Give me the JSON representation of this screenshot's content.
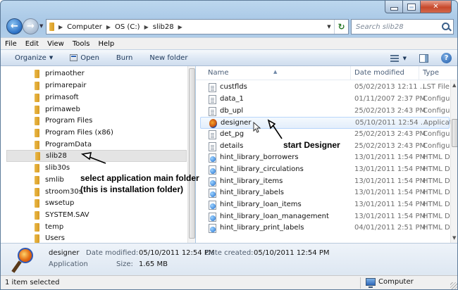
{
  "address": {
    "crumbs": [
      "Computer",
      "OS (C:)",
      "slib28"
    ]
  },
  "search": {
    "placeholder": "Search slib28"
  },
  "menubar": [
    "File",
    "Edit",
    "View",
    "Tools",
    "Help"
  ],
  "toolbar": {
    "organize": "Organize",
    "open": "Open",
    "burn": "Burn",
    "new_folder": "New folder"
  },
  "nav_items": [
    {
      "label": "primaother",
      "selected": false
    },
    {
      "label": "primarepair",
      "selected": false
    },
    {
      "label": "primasoft",
      "selected": false
    },
    {
      "label": "primaweb",
      "selected": false
    },
    {
      "label": "Program Files",
      "selected": false
    },
    {
      "label": "Program Files (x86)",
      "selected": false
    },
    {
      "label": "ProgramData",
      "selected": false
    },
    {
      "label": "slib28",
      "selected": true
    },
    {
      "label": "slib30s",
      "selected": false
    },
    {
      "label": "smlib",
      "selected": false
    },
    {
      "label": "stroom30s",
      "selected": false
    },
    {
      "label": "swsetup",
      "selected": false
    },
    {
      "label": "SYSTEM.SAV",
      "selected": false
    },
    {
      "label": "temp",
      "selected": false
    },
    {
      "label": "Users",
      "selected": false
    }
  ],
  "columns": {
    "name": "Name",
    "date": "Date modified",
    "type": "Type"
  },
  "files": [
    {
      "name": "custflds",
      "date": "05/02/2013 12:11 ...",
      "type": "LST File",
      "icon": "doc",
      "hover": false
    },
    {
      "name": "data_1",
      "date": "01/11/2007 2:37 PM",
      "type": "Configuration",
      "icon": "doc",
      "hover": false
    },
    {
      "name": "db_upl",
      "date": "25/02/2013 2:43 PM",
      "type": "Configuration",
      "icon": "doc",
      "hover": false
    },
    {
      "name": "designer",
      "date": "05/10/2011 12:54 ...",
      "type": "Application",
      "icon": "app",
      "hover": true
    },
    {
      "name": "det_pg",
      "date": "25/02/2013 2:43 PM",
      "type": "Configuration",
      "icon": "doc",
      "hover": false
    },
    {
      "name": "details",
      "date": "25/02/2013 2:43 PM",
      "type": "Configuration",
      "icon": "doc",
      "hover": false
    },
    {
      "name": "hint_library_borrowers",
      "date": "13/01/2011 1:54 PM",
      "type": "HTML Document",
      "icon": "html",
      "hover": false
    },
    {
      "name": "hint_library_circulations",
      "date": "13/01/2011 1:54 PM",
      "type": "HTML Document",
      "icon": "html",
      "hover": false
    },
    {
      "name": "hint_library_items",
      "date": "13/01/2011 1:54 PM",
      "type": "HTML Document",
      "icon": "html",
      "hover": false
    },
    {
      "name": "hint_library_labels",
      "date": "13/01/2011 1:54 PM",
      "type": "HTML Document",
      "icon": "html",
      "hover": false
    },
    {
      "name": "hint_library_loan_items",
      "date": "13/01/2011 1:54 PM",
      "type": "HTML Document",
      "icon": "html",
      "hover": false
    },
    {
      "name": "hint_library_loan_management",
      "date": "13/01/2011 1:54 PM",
      "type": "HTML Document",
      "icon": "html",
      "hover": false
    },
    {
      "name": "hint_library_print_labels",
      "date": "04/01/2011 2:51 PM",
      "type": "HTML Document",
      "icon": "html",
      "hover": false
    }
  ],
  "details": {
    "name": "designer",
    "type": "Application",
    "modified_label": "Date modified:",
    "modified": "05/10/2011 12:54 PM",
    "created_label": "Date created:",
    "created": "05/10/2011 12:54 PM",
    "size_label": "Size:",
    "size": "1.65 MB"
  },
  "status": {
    "left": "1 item selected",
    "location": "Computer"
  },
  "annotations": {
    "start": "start Designer",
    "select_line1": "select application main folder",
    "select_line2": "(this is installation folder)"
  },
  "colors": {
    "annotation_text": "#000000",
    "hover_row": "#e3eefb",
    "selected_folder": "#e4e4e4"
  }
}
